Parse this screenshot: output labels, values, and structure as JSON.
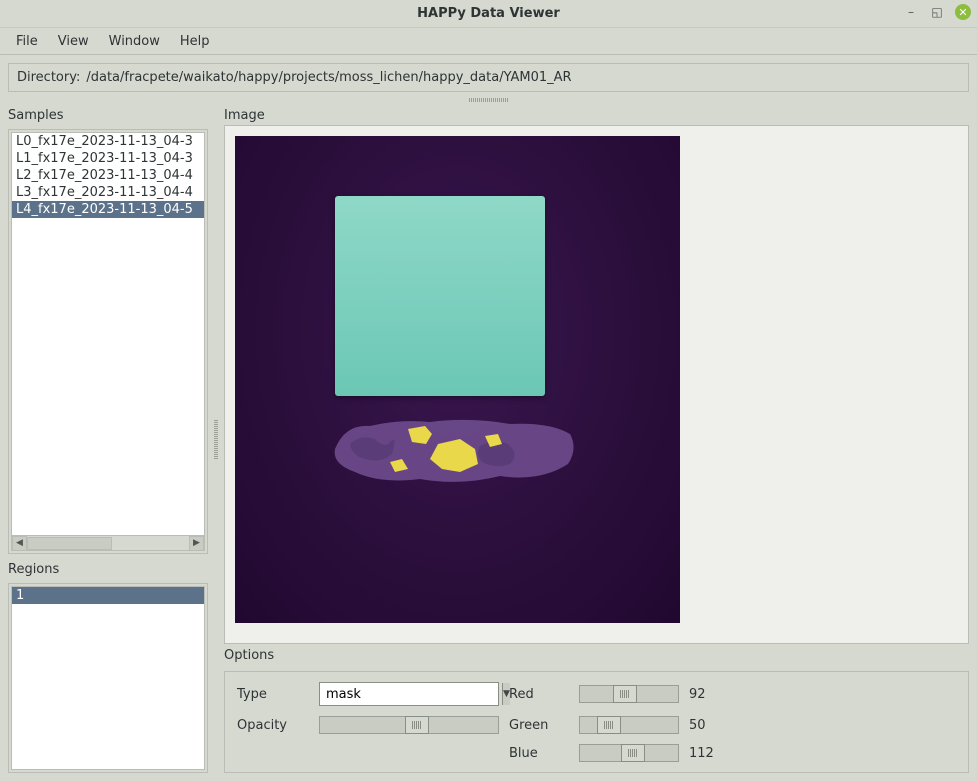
{
  "window": {
    "title": "HAPPy Data Viewer"
  },
  "menu": {
    "items": [
      "File",
      "View",
      "Window",
      "Help"
    ]
  },
  "directory": {
    "label": "Directory:",
    "path": "/data/fracpete/waikato/happy/projects/moss_lichen/happy_data/YAM01_AR"
  },
  "samples": {
    "label": "Samples",
    "items": [
      "L0_fx17e_2023-11-13_04-3",
      "L1_fx17e_2023-11-13_04-3",
      "L2_fx17e_2023-11-13_04-4",
      "L3_fx17e_2023-11-13_04-4",
      "L4_fx17e_2023-11-13_04-5"
    ],
    "selected_index": 4
  },
  "regions": {
    "label": "Regions",
    "items": [
      "1"
    ],
    "selected_index": 0
  },
  "image": {
    "label": "Image"
  },
  "options": {
    "label": "Options",
    "type_label": "Type",
    "type_value": "mask",
    "opacity_label": "Opacity",
    "opacity_value": 50,
    "red_label": "Red",
    "red_value": "92",
    "green_label": "Green",
    "green_value": "50",
    "blue_label": "Blue",
    "blue_value": "112"
  }
}
